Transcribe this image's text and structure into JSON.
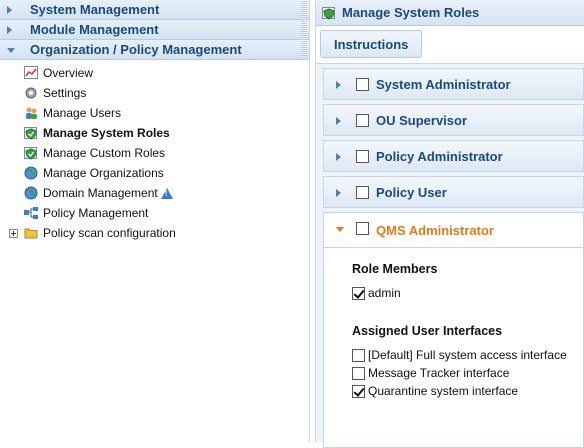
{
  "left": {
    "sections": [
      {
        "label": "System Management",
        "expanded": false
      },
      {
        "label": "Module Management",
        "expanded": false
      },
      {
        "label": "Organization / Policy Management",
        "expanded": true
      }
    ],
    "tree": [
      {
        "label": "Overview",
        "icon": "chart-icon"
      },
      {
        "label": "Settings",
        "icon": "gear-icon"
      },
      {
        "label": "Manage Users",
        "icon": "users-icon"
      },
      {
        "label": "Manage System Roles",
        "icon": "shield-icon",
        "selected": true
      },
      {
        "label": "Manage Custom Roles",
        "icon": "shield-icon"
      },
      {
        "label": "Manage Organizations",
        "icon": "globe-icon"
      },
      {
        "label": "Domain Management",
        "icon": "globe-icon",
        "warning": true
      },
      {
        "label": "Policy Management",
        "icon": "network-icon"
      },
      {
        "label": "Policy scan configuration",
        "icon": "folder-icon",
        "expandable": true
      }
    ]
  },
  "right": {
    "title": "Manage System Roles",
    "instructions_label": "Instructions",
    "roles": [
      {
        "label": "System Administrator",
        "expanded": false,
        "checked": false
      },
      {
        "label": "OU Supervisor",
        "expanded": false,
        "checked": false
      },
      {
        "label": "Policy Administrator",
        "expanded": false,
        "checked": false
      },
      {
        "label": "Policy User",
        "expanded": false,
        "checked": false
      },
      {
        "label": "QMS Administrator",
        "expanded": true,
        "checked": false
      }
    ],
    "detail": {
      "members_title": "Role Members",
      "members": [
        {
          "label": "admin",
          "checked": true
        }
      ],
      "interfaces_title": "Assigned User Interfaces",
      "interfaces": [
        {
          "label": "[Default] Full system access interface",
          "checked": false
        },
        {
          "label": "Message Tracker interface",
          "checked": false
        },
        {
          "label": "Quarantine system interface",
          "checked": true
        }
      ]
    }
  },
  "colors": {
    "accent": "#1b4a7a",
    "active": "#e07a18",
    "header_bg": "#dde8f4"
  }
}
